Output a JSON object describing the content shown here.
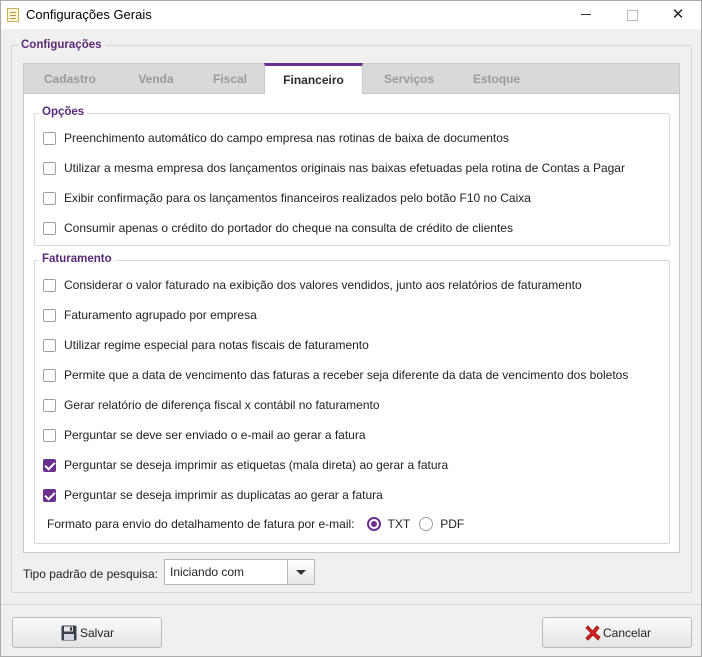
{
  "window": {
    "title": "Configurações Gerais"
  },
  "group": {
    "title": "Configurações"
  },
  "tabs": [
    {
      "label": "Cadastro",
      "active": false
    },
    {
      "label": "Venda",
      "active": false
    },
    {
      "label": "Fiscal",
      "active": false
    },
    {
      "label": "Financeiro",
      "active": true
    },
    {
      "label": "Serviços",
      "active": false
    },
    {
      "label": "Estoque",
      "active": false
    }
  ],
  "opcoes": {
    "title": "Opções",
    "items": [
      {
        "label": "Preenchimento automático do campo empresa nas rotinas de baixa de documentos",
        "checked": false
      },
      {
        "label": "Utilizar a mesma empresa dos lançamentos originais nas baixas efetuadas pela rotina de Contas a Pagar",
        "checked": false
      },
      {
        "label": "Exibir confirmação para os lançamentos financeiros realizados pelo botão F10 no Caixa",
        "checked": false
      },
      {
        "label": "Consumir apenas o crédito do portador do cheque na consulta de crédito de clientes",
        "checked": false
      }
    ]
  },
  "faturamento": {
    "title": "Faturamento",
    "items": [
      {
        "label": "Considerar o valor faturado na exibição dos valores vendidos, junto aos relatórios de faturamento",
        "checked": false
      },
      {
        "label": "Faturamento agrupado por empresa",
        "checked": false
      },
      {
        "label": "Utilizar regime especial para notas fiscais de faturamento",
        "checked": false
      },
      {
        "label": "Permite que a data de vencimento das faturas a receber seja diferente da data de vencimento dos boletos",
        "checked": false
      },
      {
        "label": "Gerar relatório de diferença fiscal x contábil no faturamento",
        "checked": false
      },
      {
        "label": "Perguntar se deve ser enviado o e-mail ao gerar a fatura",
        "checked": false
      },
      {
        "label": "Perguntar se deseja imprimir as etiquetas (mala direta) ao gerar a fatura",
        "checked": true
      },
      {
        "label": "Perguntar se deseja imprimir as duplicatas ao gerar a fatura",
        "checked": true
      }
    ],
    "formato": {
      "label": "Formato para envio do detalhamento de fatura por e-mail:",
      "options": [
        "TXT",
        "PDF"
      ],
      "selected": "TXT"
    }
  },
  "search": {
    "label": "Tipo padrão de pesquisa:",
    "value": "Iniciando com"
  },
  "buttons": {
    "save": "Salvar",
    "cancel": "Cancelar"
  },
  "colors": {
    "accent": "#6b2f8e",
    "panel": "#ffffff",
    "background": "#f0f0f0"
  },
  "icons": {
    "save": "floppy-disk-icon",
    "cancel": "red-x-icon",
    "app": "document-icon"
  }
}
